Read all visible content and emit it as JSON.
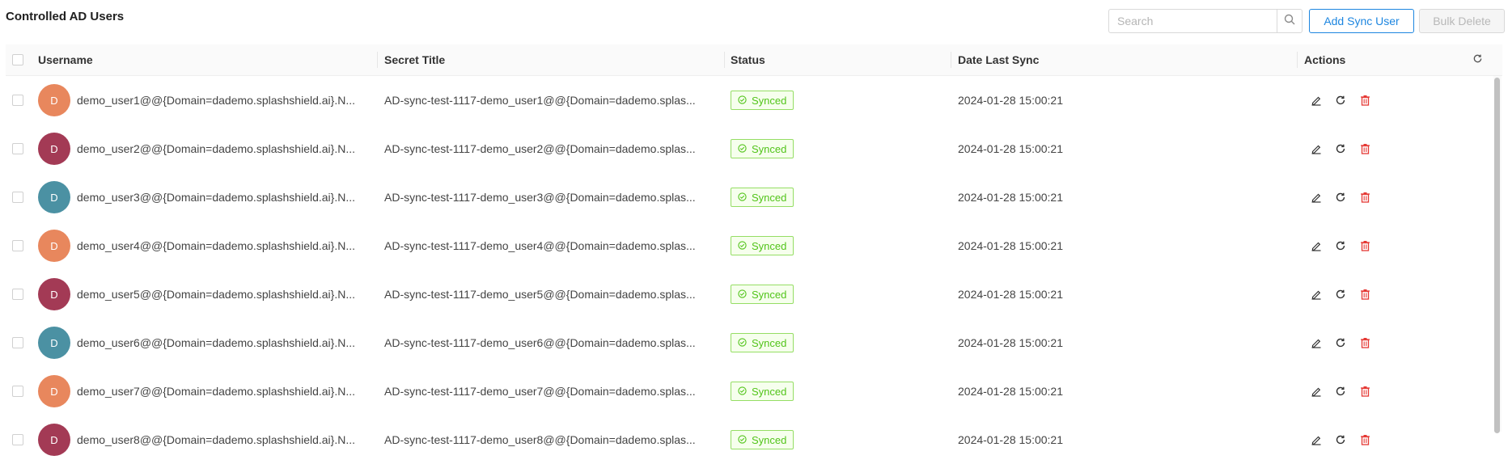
{
  "header": {
    "title": "Controlled AD Users",
    "search_placeholder": "Search",
    "search_value": "",
    "add_label": "Add Sync User",
    "bulk_delete_label": "Bulk Delete"
  },
  "columns": {
    "username": "Username",
    "secret_title": "Secret Title",
    "status": "Status",
    "date_last_sync": "Date Last Sync",
    "actions": "Actions"
  },
  "colors": {
    "accent": "#1d86e0",
    "synced_green": "#52c41a",
    "delete_red": "#e53935",
    "avatar_orange": "#e8875d",
    "avatar_maroon": "#a33a55",
    "avatar_teal": "#4b91a3"
  },
  "icons": {
    "search": "search-icon",
    "refresh": "refresh-icon",
    "edit": "edit-icon",
    "sync": "sync-icon",
    "delete": "delete-icon",
    "synced": "check-circle-icon"
  },
  "rows": [
    {
      "avatar": "D",
      "avatar_color": "#e8875d",
      "username": "demo_user1@@{Domain=dademo.splashshield.ai}.N...",
      "secret_title": "AD-sync-test-1117-demo_user1@@{Domain=dademo.splas...",
      "status": "Synced",
      "date": "2024-01-28 15:00:21"
    },
    {
      "avatar": "D",
      "avatar_color": "#a33a55",
      "username": "demo_user2@@{Domain=dademo.splashshield.ai}.N...",
      "secret_title": "AD-sync-test-1117-demo_user2@@{Domain=dademo.splas...",
      "status": "Synced",
      "date": "2024-01-28 15:00:21"
    },
    {
      "avatar": "D",
      "avatar_color": "#4b91a3",
      "username": "demo_user3@@{Domain=dademo.splashshield.ai}.N...",
      "secret_title": "AD-sync-test-1117-demo_user3@@{Domain=dademo.splas...",
      "status": "Synced",
      "date": "2024-01-28 15:00:21"
    },
    {
      "avatar": "D",
      "avatar_color": "#e8875d",
      "username": "demo_user4@@{Domain=dademo.splashshield.ai}.N...",
      "secret_title": "AD-sync-test-1117-demo_user4@@{Domain=dademo.splas...",
      "status": "Synced",
      "date": "2024-01-28 15:00:21"
    },
    {
      "avatar": "D",
      "avatar_color": "#a33a55",
      "username": "demo_user5@@{Domain=dademo.splashshield.ai}.N...",
      "secret_title": "AD-sync-test-1117-demo_user5@@{Domain=dademo.splas...",
      "status": "Synced",
      "date": "2024-01-28 15:00:21"
    },
    {
      "avatar": "D",
      "avatar_color": "#4b91a3",
      "username": "demo_user6@@{Domain=dademo.splashshield.ai}.N...",
      "secret_title": "AD-sync-test-1117-demo_user6@@{Domain=dademo.splas...",
      "status": "Synced",
      "date": "2024-01-28 15:00:21"
    },
    {
      "avatar": "D",
      "avatar_color": "#e8875d",
      "username": "demo_user7@@{Domain=dademo.splashshield.ai}.N...",
      "secret_title": "AD-sync-test-1117-demo_user7@@{Domain=dademo.splas...",
      "status": "Synced",
      "date": "2024-01-28 15:00:21"
    },
    {
      "avatar": "D",
      "avatar_color": "#a33a55",
      "username": "demo_user8@@{Domain=dademo.splashshield.ai}.N...",
      "secret_title": "AD-sync-test-1117-demo_user8@@{Domain=dademo.splas...",
      "status": "Synced",
      "date": "2024-01-28 15:00:21"
    }
  ]
}
